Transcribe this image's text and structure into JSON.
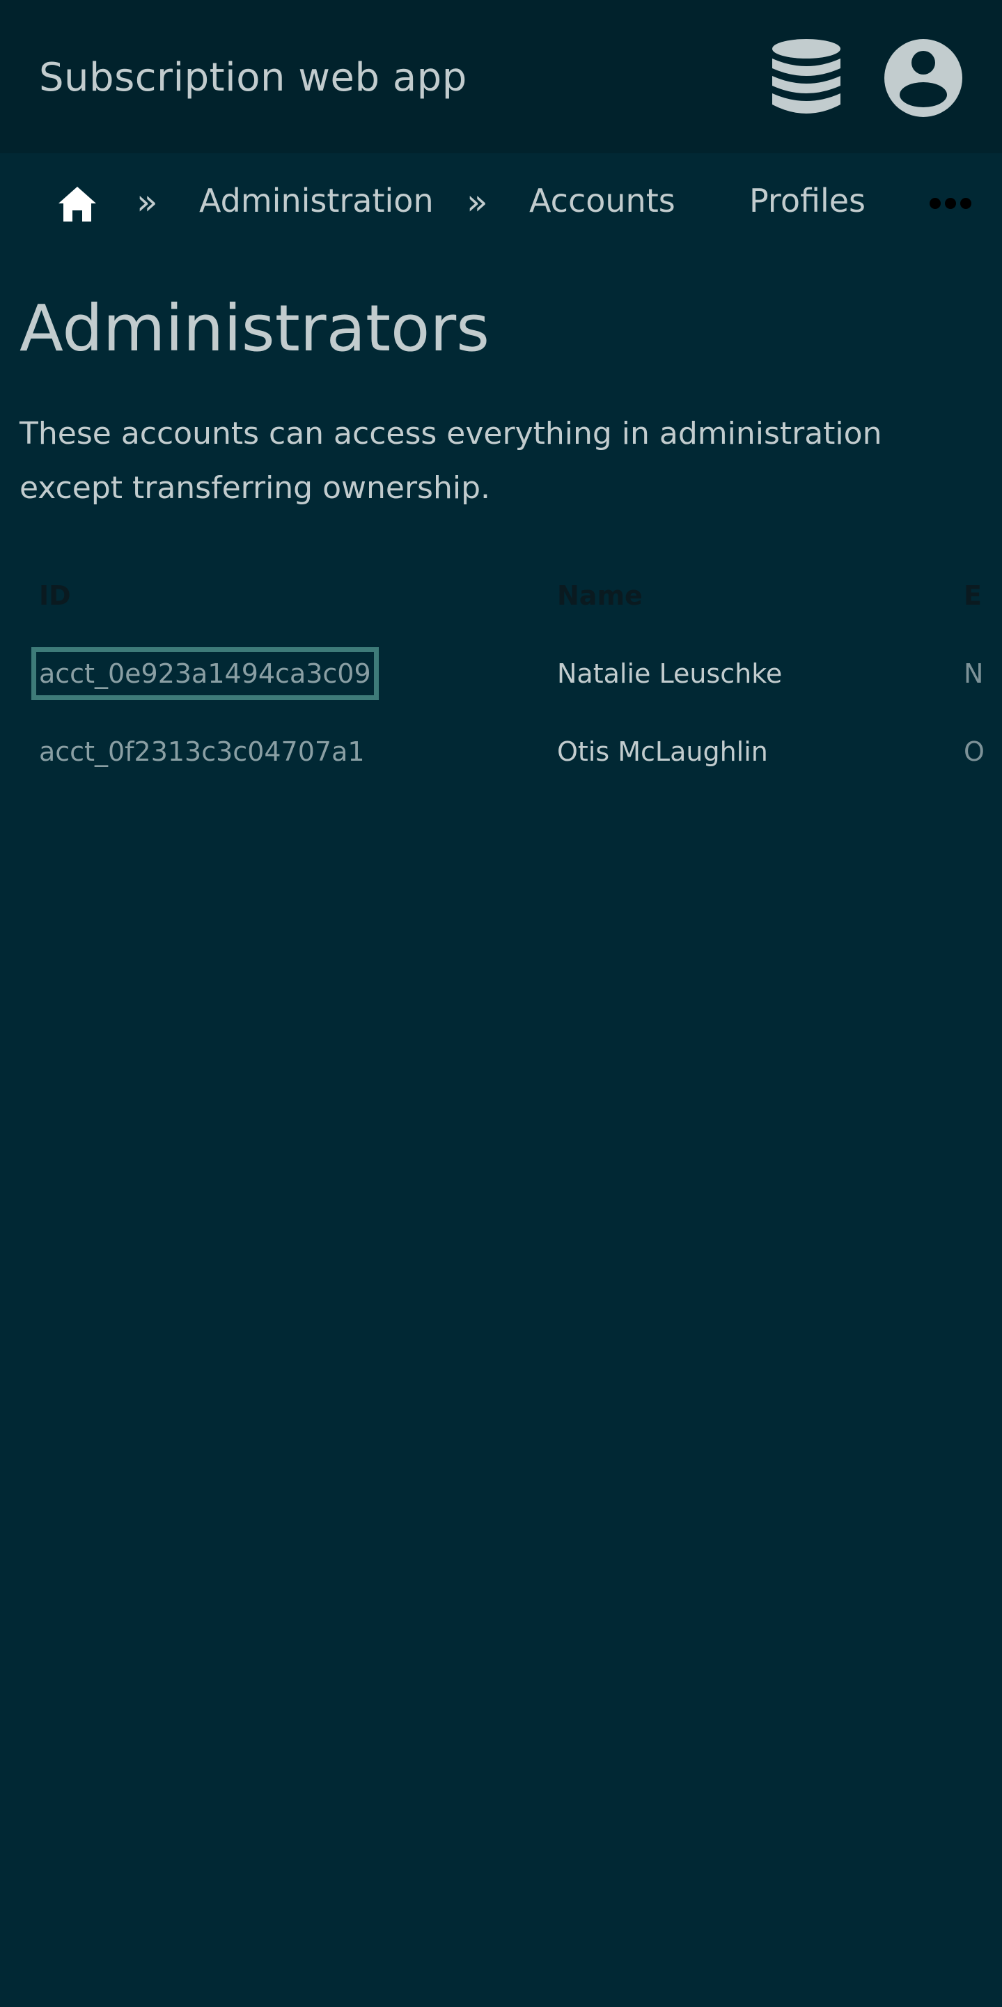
{
  "header": {
    "app_title": "Subscription web app",
    "icons": {
      "database": "database-icon",
      "account": "account-circle-icon"
    }
  },
  "breadcrumb": {
    "home_icon": "home-icon",
    "separator": "»",
    "items": [
      {
        "label": "Administration"
      },
      {
        "label": "Accounts"
      },
      {
        "label": "Profiles"
      }
    ],
    "overflow_icon": "more-horizontal-icon"
  },
  "page": {
    "title": "Administrators",
    "description": "These accounts can access everything in administration except transferring ownership."
  },
  "table": {
    "columns": [
      "ID",
      "Name",
      "E"
    ],
    "rows": [
      {
        "id": "acct_0e923a1494ca3c09",
        "name": "Natalie Leuschke",
        "e": "N",
        "focused": true
      },
      {
        "id": "acct_0f2313c3c04707a1",
        "name": "Otis McLaughlin",
        "e": "O",
        "focused": false
      }
    ]
  },
  "colors": {
    "background": "#012834",
    "header_background": "#01222c",
    "text": "#c2ccce",
    "muted_text": "#8a9fa4",
    "focus_outline": "#3e7b79"
  }
}
